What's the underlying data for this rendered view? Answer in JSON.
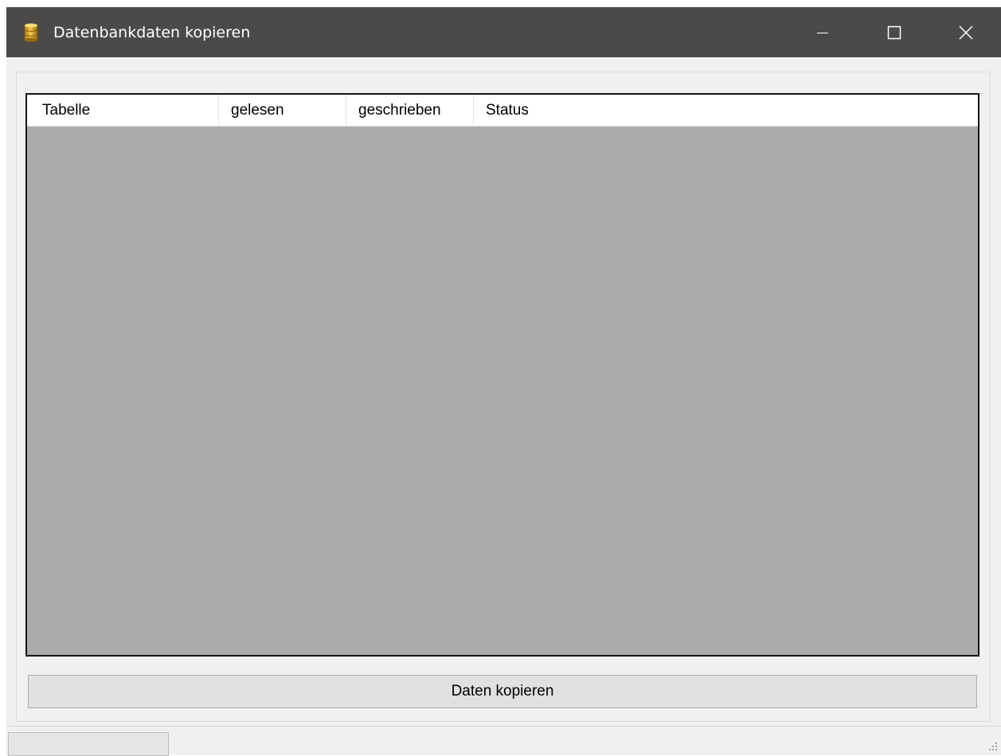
{
  "window": {
    "title": "Datenbankdaten kopieren",
    "icon": "database-icon",
    "controls": {
      "minimize": "minimize-icon",
      "maximize": "maximize-icon",
      "close": "close-icon"
    }
  },
  "listview": {
    "columns": [
      "Tabelle",
      "gelesen",
      "geschrieben",
      "Status"
    ],
    "rows": []
  },
  "copy_button": {
    "label": "Daten kopieren"
  },
  "statusbar": {
    "progress": 0
  },
  "colors": {
    "titlebar": "#4c4a48",
    "window_bg": "#f0f0f0",
    "list_bg": "#ababab",
    "button_bg": "#e1e1e1"
  }
}
